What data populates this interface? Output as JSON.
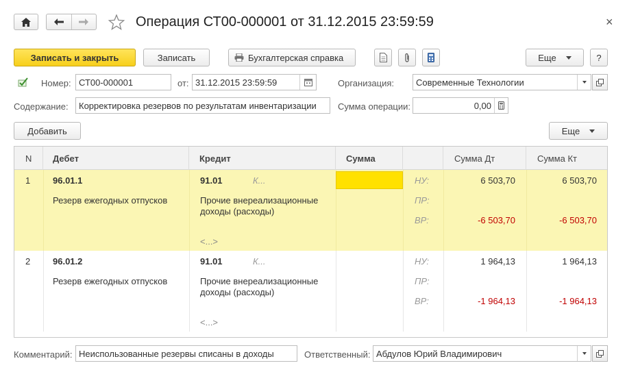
{
  "title": "Операция СТ00-000001 от 31.12.2015 23:59:59",
  "close_glyph": "×",
  "toolbar": {
    "save_close": "Записать и закрыть",
    "save": "Записать",
    "report": "Бухгалтерская справка",
    "more": "Еще",
    "help": "?"
  },
  "form": {
    "number_label": "Номер:",
    "number_value": "СТ00-000001",
    "date_label": "от:",
    "date_value": "31.12.2015 23:59:59",
    "org_label": "Организация:",
    "org_value": "Современные Технологии",
    "content_label": "Содержание:",
    "content_value": "Корректировка резервов по результатам инвентаризации",
    "sum_label": "Сумма операции:",
    "sum_value": "0,00"
  },
  "table_bar": {
    "add": "Добавить",
    "more": "Еще"
  },
  "table": {
    "headers": {
      "n": "N",
      "debit": "Дебет",
      "credit": "Кредит",
      "sum": "Сумма",
      "sum_dt": "Сумма Дт",
      "sum_kt": "Сумма Кт"
    },
    "rows": [
      {
        "n": "1",
        "debit_account": "96.01.1",
        "debit_desc": "Резерв ежегодных отпусков",
        "credit_account": "91.01",
        "credit_k": "К...",
        "credit_desc_1": "Прочие внереализационные",
        "credit_desc_2": "доходы (расходы)",
        "credit_sub": "<...>",
        "nu_label": "НУ:",
        "pr_label": "ПР:",
        "vr_label": "ВР:",
        "nu_dt": "6 503,70",
        "nu_kt": "6 503,70",
        "vr_dt": "-6 503,70",
        "vr_kt": "-6 503,70"
      },
      {
        "n": "2",
        "debit_account": "96.01.2",
        "debit_desc": "Резерв ежегодных отпусков",
        "credit_account": "91.01",
        "credit_k": "К...",
        "credit_desc_1": "Прочие внереализационные",
        "credit_desc_2": "доходы (расходы)",
        "credit_sub": "<...>",
        "nu_label": "НУ:",
        "pr_label": "ПР:",
        "vr_label": "ВР:",
        "nu_dt": "1 964,13",
        "nu_kt": "1 964,13",
        "vr_dt": "-1 964,13",
        "vr_kt": "-1 964,13"
      }
    ]
  },
  "footer": {
    "comment_label": "Комментарий:",
    "comment_value": "Неиспользованные резервы списаны в доходы",
    "resp_label": "Ответственный:",
    "resp_value": "Абдулов Юрий Владимирович"
  },
  "colors": {
    "primary_button": "#f7cf1c",
    "selected_row": "#fbf6b4",
    "selected_cell": "#ffe100",
    "negative": "#c00000"
  }
}
